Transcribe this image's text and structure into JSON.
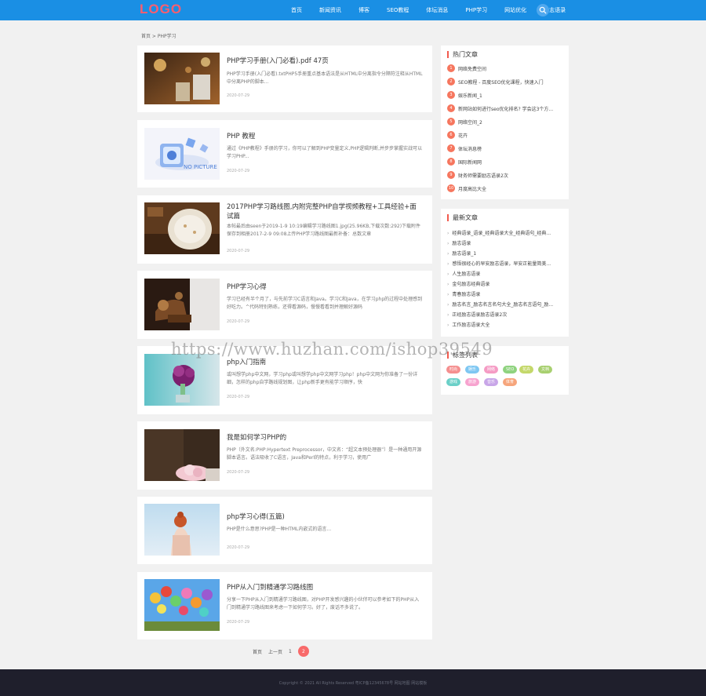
{
  "header": {
    "logo": "LOGO",
    "nav": [
      "首页",
      "新闻资讯",
      "博客",
      "SEO教程",
      "体坛消息",
      "PHP学习",
      "网站优化",
      "励志语录"
    ]
  },
  "breadcrumb": "首页 > PHP学习",
  "articles": [
    {
      "title": "PHP学习手册(入门必看).pdf 47页",
      "desc": "PHP学习手册(入门必看).txtPHP5手册重点基本语法是从HTML中分离指令分隔符注释从HTML中分离PHP的脚本...",
      "date": "2020-07-29"
    },
    {
      "title": "PHP 教程",
      "desc": "通过《PHP教程》手册的学习，你可以了解到PHP变量定义,PHP逻辑判断,并步步掌握实战可以学习PHP...",
      "date": "2020-07-29"
    },
    {
      "title": "2017PHP学习路线图,内附完整PHP自学视频教程+工具经验+面试篇",
      "desc": "本帖最后由seen于2019-1-9 10:19编辑学习路线图1.jpg(25.96KB,下载次数:292)下载附件保存到相册2017-2-9 09:08上传PHP学习路线图最新补备：总数文章",
      "date": "2020-07-29"
    },
    {
      "title": "PHP学习心得",
      "desc": "学习已经有半个月了，与先前学习C语言和Java。学习C和Java，在学习php的过程中处理感到好吃力。^代码特别熟练，还得看源码，慢慢看看到并理解好源码",
      "date": "2020-07-29"
    },
    {
      "title": "php入门指南",
      "desc": "或叫想学php中文网，学习php或叫想学php中文网学习php！php中文网为你准备了一份详细，怎样的php自学路线规划图，让php新手更有能学习顺序，快",
      "date": "2020-07-29"
    },
    {
      "title": "我是如何学习PHP的",
      "desc": "PHP（外文名:PHP:Hypertext Preprocessor，中文名：“超文本预处理器”）是一种通用开源脚本语言。语法吸收了C语言，Java和Perl的特点，利于学习，使用广",
      "date": "2020-07-29"
    },
    {
      "title": "php学习心得(五篇)",
      "desc": "PHP是什么意思?PHP是一种HTML内嵌式的语言...",
      "date": "2020-07-29"
    },
    {
      "title": "PHP从入门到精通学习路线图",
      "desc": "分享一下PHP从入门到精通学习路线图，对PHP开发感兴趣的小伙伴可以参考如下的PHP从入门到精通学习路线图来考虑一下如何学习。好了，废话不多说了。",
      "date": "2020-07-29"
    }
  ],
  "thumb_labels": {
    "no_picture": "NO PICTURE"
  },
  "pager": {
    "first": "首页",
    "prev": "上一页",
    "page1": "1",
    "page2": "2"
  },
  "hot": {
    "title": "热门文章",
    "items": [
      {
        "n": "1",
        "t": "网络免费空间"
      },
      {
        "n": "2",
        "t": "SEO教程 - 百度SEO优化课程，快速入门"
      },
      {
        "n": "3",
        "t": "娱乐新闻_1"
      },
      {
        "n": "4",
        "t": "新网站如何进行seo优化排名? 学会这3个方..."
      },
      {
        "n": "5",
        "t": "网络空间_2"
      },
      {
        "n": "6",
        "t": "花卉"
      },
      {
        "n": "7",
        "t": "体坛消息榜"
      },
      {
        "n": "8",
        "t": "国际新闻网"
      },
      {
        "n": "9",
        "t": "财务师需要励志语录2次"
      },
      {
        "n": "10",
        "t": "月度高比大全"
      }
    ]
  },
  "latest": {
    "title": "最新文章",
    "items": [
      "经典语录_语录_经典语录大全_经典语句_经典...",
      "励志语录",
      "励志语录_1",
      "感悟很经心的早安励志语录，早安正能量简美...",
      "人生励志语录",
      "金句励志经典语录",
      "青春励志语录",
      "励志名言_励志名言名句大全_励志名言语句_励...",
      "正经励志语录励志语录2次",
      "工作励志语录大全"
    ]
  },
  "tags": {
    "title": "标签列表",
    "items": [
      {
        "t": "时尚",
        "c": "#f58f8f"
      },
      {
        "t": "娱乐",
        "c": "#7ec7f2"
      },
      {
        "t": "网络",
        "c": "#f59bc4"
      },
      {
        "t": "SEO",
        "c": "#8fd37f"
      },
      {
        "t": "花卉",
        "c": "#c4d86a"
      },
      {
        "t": "文档",
        "c": "#a8d070"
      },
      {
        "t": "游戏",
        "c": "#6bd0c8"
      },
      {
        "t": "旅游",
        "c": "#f7a3cf"
      },
      {
        "t": "音乐",
        "c": "#c8a6e8"
      },
      {
        "t": "体育",
        "c": "#f6a57c"
      }
    ]
  },
  "watermark": "https://www.huzhan.com/ishop39549",
  "footer": "Copyright © 2021 All Rights Reserved 粤ICP备12345678号 网站地图 网站模板"
}
